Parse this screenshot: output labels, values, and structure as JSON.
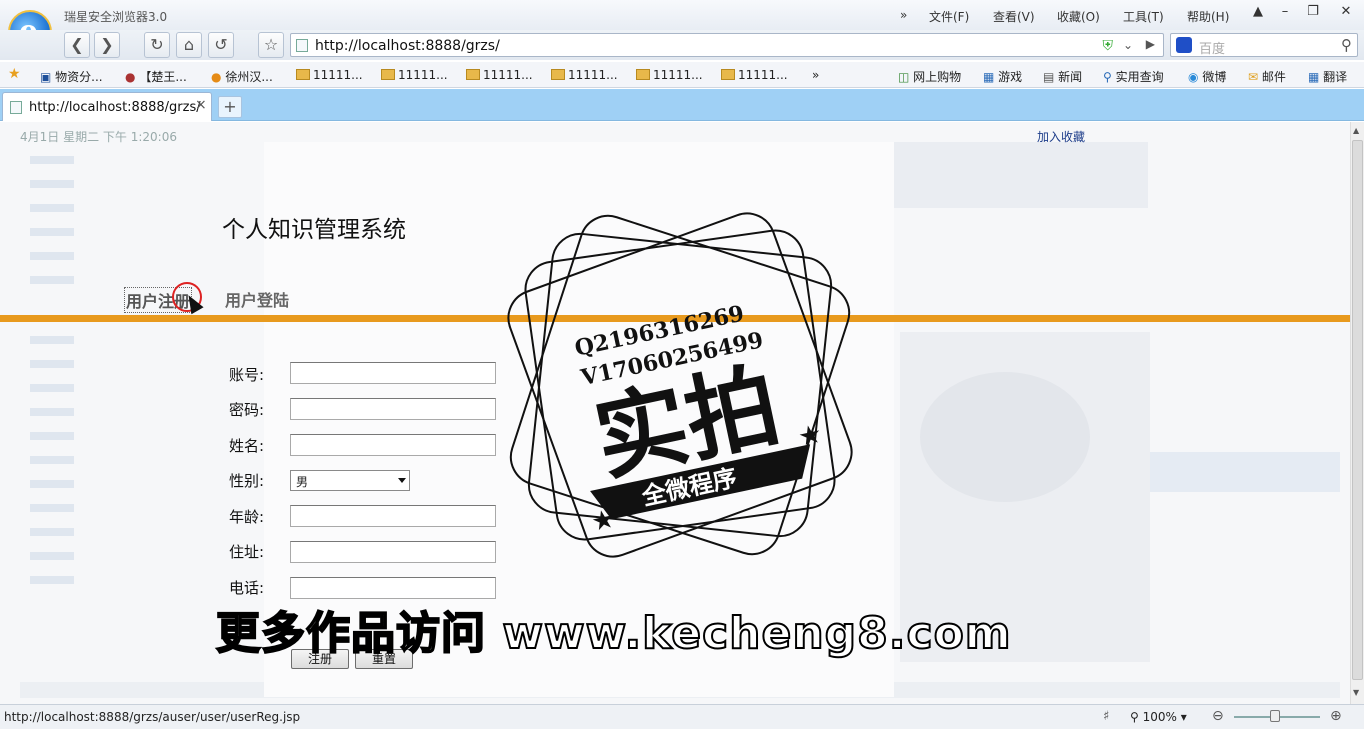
{
  "window": {
    "title": "瑞星安全浏览器3.0",
    "menus": [
      "文件(F)",
      "查看(V)",
      "收藏(O)",
      "工具(T)",
      "帮助(H)"
    ],
    "chevron": "»"
  },
  "navbar": {
    "url": "http://localhost:8888/grzs/",
    "search_placeholder": "百度"
  },
  "favorites": {
    "items": [
      "物资分...",
      "【楚王...",
      "徐州汉...",
      "11111...",
      "11111...",
      "11111...",
      "11111...",
      "11111...",
      "11111..."
    ],
    "more": "»",
    "right_items": [
      "网上购物",
      "游戏",
      "新闻",
      "实用查询",
      "微博",
      "邮件",
      "翻译"
    ]
  },
  "tab": {
    "title": "http://localhost:8888/grzs/",
    "close": "×",
    "new": "+"
  },
  "page": {
    "datetime": "4月1日 星期二 下午 1:20:06",
    "bookmark_link": "加入收藏",
    "system_title": "个人知识管理系统",
    "nav": {
      "register": "用户注册",
      "login": "用户登陆"
    },
    "form": {
      "fields": [
        {
          "label": "账号:",
          "value": ""
        },
        {
          "label": "密码:",
          "value": ""
        },
        {
          "label": "姓名:",
          "value": ""
        },
        {
          "label": "性别:",
          "value": "男"
        },
        {
          "label": "年龄:",
          "value": ""
        },
        {
          "label": "住址:",
          "value": ""
        },
        {
          "label": "电话:",
          "value": ""
        }
      ],
      "submit": "注册",
      "reset": "重置"
    }
  },
  "overlay": {
    "stamp_lines": [
      "Q2196316269",
      "V17060256499",
      "实拍",
      "全微程序"
    ],
    "url_banner": "更多作品访问 www.kecheng8.com"
  },
  "statusbar": {
    "link": "http://localhost:8888/grzs/auser/user/userReg.jsp",
    "zoom": "100%"
  },
  "colors": {
    "accent_bar": "#e89a1e",
    "tab_bar": "#9fd0f5",
    "link": "#1d3d8a"
  }
}
